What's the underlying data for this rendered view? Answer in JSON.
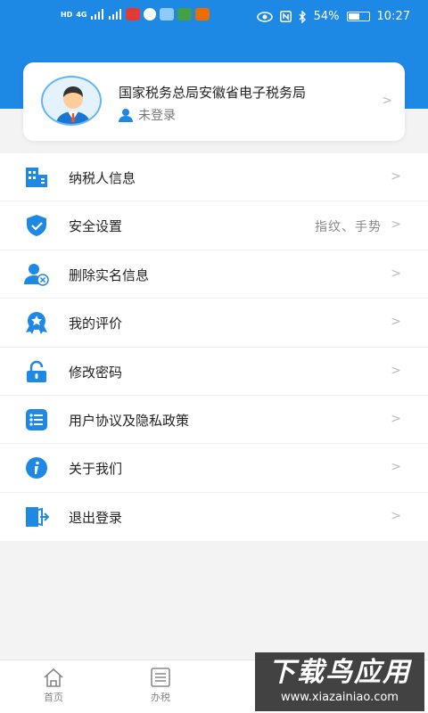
{
  "status_bar": {
    "battery": "54%",
    "time": "10:27",
    "carrier_left": "HD",
    "network": "4G"
  },
  "profile": {
    "org_name": "国家税务总局安徽省电子税务局",
    "login_status": "未登录"
  },
  "menu": [
    {
      "label": "纳税人信息",
      "value": "",
      "icon": "building-icon"
    },
    {
      "label": "安全设置",
      "value": "指纹、手势",
      "icon": "shield-check-icon"
    },
    {
      "label": "删除实名信息",
      "value": "",
      "icon": "user-remove-icon"
    },
    {
      "label": "我的评价",
      "value": "",
      "icon": "star-badge-icon"
    },
    {
      "label": "修改密码",
      "value": "",
      "icon": "unlock-icon"
    },
    {
      "label": "用户协议及隐私政策",
      "value": "",
      "icon": "list-icon"
    },
    {
      "label": "关于我们",
      "value": "",
      "icon": "info-icon"
    },
    {
      "label": "退出登录",
      "value": "",
      "icon": "logout-icon"
    }
  ],
  "tabbar": [
    {
      "label": "首页",
      "icon": "home-icon"
    },
    {
      "label": "办税",
      "icon": "tax-list-icon"
    }
  ],
  "watermark": {
    "main": "下载鸟应用",
    "sub": "www.xiazainiao.com"
  },
  "colors": {
    "primary": "#1e88e5",
    "background": "#f3f3f3"
  }
}
